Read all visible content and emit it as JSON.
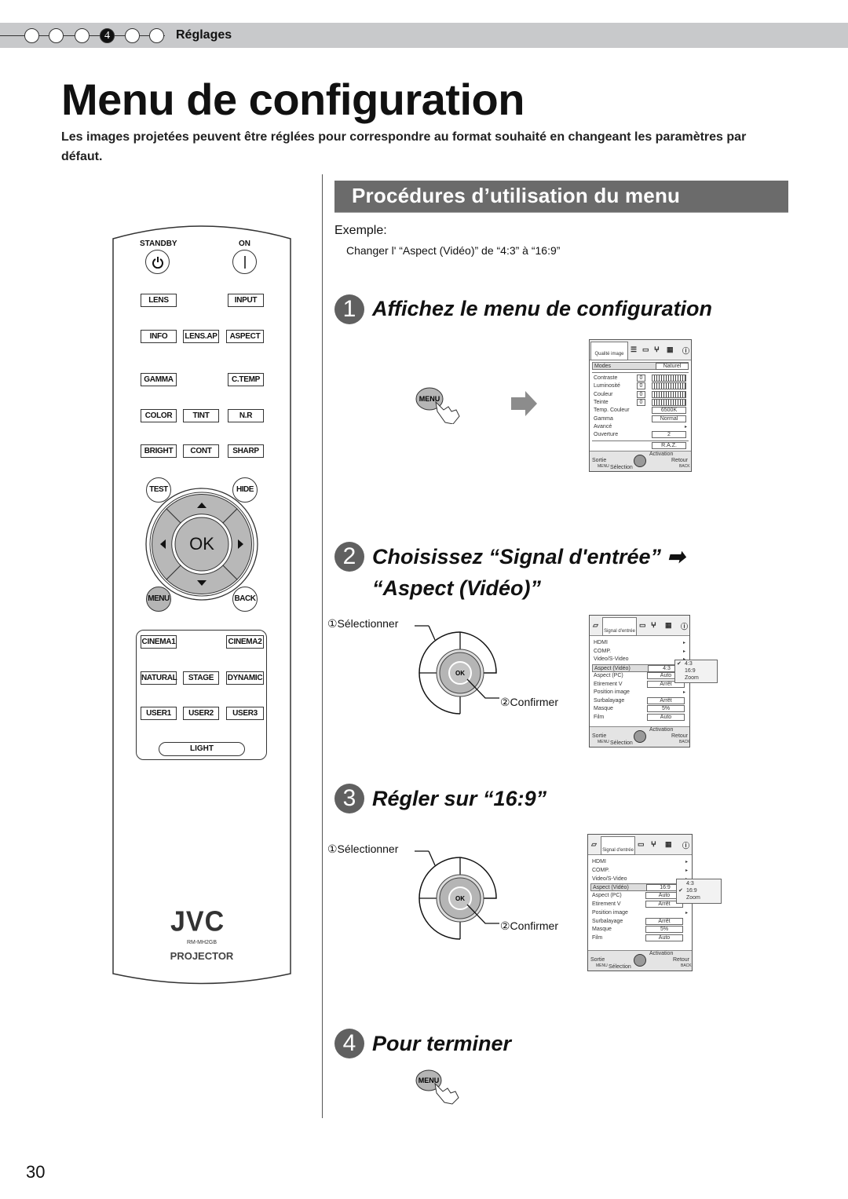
{
  "header": {
    "chapter_steps": [
      "",
      "",
      "",
      "4",
      "",
      ""
    ],
    "active_step": 4,
    "chapter_label": "Réglages"
  },
  "page": {
    "title": "Menu de configuration",
    "intro": "Les images projetées peuvent être réglées pour correspondre au format souhaité en changeant les paramètres par défaut.",
    "page_number": "30"
  },
  "remote": {
    "top_labels": {
      "standby": "STANDBY",
      "on": "ON"
    },
    "rows": [
      [
        "LENS",
        "",
        "INPUT"
      ],
      [
        "INFO",
        "LENS.AP",
        "ASPECT"
      ],
      [
        "GAMMA",
        "",
        "C.TEMP"
      ],
      [
        "COLOR",
        "TINT",
        "N.R"
      ],
      [
        "BRIGHT",
        "CONT",
        "SHARP"
      ]
    ],
    "nav": {
      "test": "TEST",
      "hide": "HIDE",
      "ok": "OK",
      "menu": "MENU",
      "back": "BACK"
    },
    "presets": [
      [
        "CINEMA1",
        "",
        "CINEMA2"
      ],
      [
        "NATURAL",
        "STAGE",
        "DYNAMIC"
      ],
      [
        "USER1",
        "USER2",
        "USER3"
      ]
    ],
    "light": "LIGHT",
    "brand": "JVC",
    "model": "RM-MH2GB",
    "product": "PROJECTOR"
  },
  "section": {
    "title": "Procédures d’utilisation du menu",
    "example_label": "Exemple:",
    "example_text": "Changer l' “Aspect (Vidéo)” de “4:3” à “16:9”"
  },
  "steps": [
    {
      "num": "1",
      "title": "Affichez le menu de configuration"
    },
    {
      "num": "2",
      "title": "Choisissez “Signal d'entrée” ➡",
      "title2": "“Aspect (Vidéo)”"
    },
    {
      "num": "3",
      "title": "Régler sur “16:9”"
    },
    {
      "num": "4",
      "title": "Pour terminer"
    }
  ],
  "menu_button_label": "MENU",
  "callouts": {
    "select": "①Sélectionner",
    "confirm": "②Confirmer",
    "ok": "OK"
  },
  "osd_picture": {
    "active_tab": "Qualité image",
    "mode_label": "Modes",
    "mode_value": "Naturel",
    "rows": [
      {
        "label": "Contraste",
        "num": "0"
      },
      {
        "label": "Luminosité",
        "num": "0"
      },
      {
        "label": "Couleur",
        "num": "0"
      },
      {
        "label": "Teinte",
        "num": "0"
      },
      {
        "label": "Temp. Couleur",
        "value": "6500K"
      },
      {
        "label": "Gamma",
        "value": "Normal"
      },
      {
        "label": "Avancé",
        "arrow": "▸"
      },
      {
        "label": "Ouverture",
        "value": "2"
      }
    ],
    "reset": "R.A.Z.",
    "footer": {
      "exit": "Sortie",
      "exit_key": "MENU",
      "select": "Sélection",
      "activate": "Activation",
      "back": "Retour",
      "back_key": "BACK"
    }
  },
  "osd_signal_before": {
    "active_tab": "Signal d'entrée",
    "rows": [
      {
        "label": "HDMI",
        "arrow": "▸"
      },
      {
        "label": "COMP.",
        "arrow": "▸"
      },
      {
        "label": "Video/S-Video",
        "arrow": "▸"
      },
      {
        "label": "Aspect (Vidéo)",
        "value": "4:3",
        "highlight": true
      },
      {
        "label": "Aspect (PC)",
        "value": "Auto"
      },
      {
        "label": "Etirement V",
        "value": "Arrêt"
      },
      {
        "label": "Position image",
        "arrow": "▸"
      },
      {
        "label": "Surbalayage",
        "value": "Arrêt"
      },
      {
        "label": "Masque",
        "value": "5%"
      },
      {
        "label": "Film",
        "value": "Auto"
      }
    ],
    "popup_options": [
      "4:3",
      "16:9",
      "Zoom"
    ],
    "popup_selected": "4:3",
    "footer": {
      "exit": "Sortie",
      "exit_key": "MENU",
      "select": "Sélection",
      "activate": "Activation",
      "back": "Retour",
      "back_key": "BACK"
    }
  },
  "osd_signal_after": {
    "active_tab": "Signal d'entrée",
    "rows": [
      {
        "label": "HDMI",
        "arrow": "▸"
      },
      {
        "label": "COMP.",
        "arrow": "▸"
      },
      {
        "label": "Video/S-Video",
        "arrow": "▸"
      },
      {
        "label": "Aspect (Vidéo)",
        "value": "16:9",
        "highlight": true
      },
      {
        "label": "Aspect (PC)",
        "value": "Auto"
      },
      {
        "label": "Etirement V",
        "value": "Arrêt"
      },
      {
        "label": "Position image",
        "arrow": "▸"
      },
      {
        "label": "Surbalayage",
        "value": "Arrêt"
      },
      {
        "label": "Masque",
        "value": "5%"
      },
      {
        "label": "Film",
        "value": "Auto"
      }
    ],
    "popup_options": [
      "4:3",
      "16:9",
      "Zoom"
    ],
    "popup_selected": "16:9",
    "footer": {
      "exit": "Sortie",
      "exit_key": "MENU",
      "select": "Sélection",
      "activate": "Activation",
      "back": "Retour",
      "back_key": "BACK"
    }
  }
}
